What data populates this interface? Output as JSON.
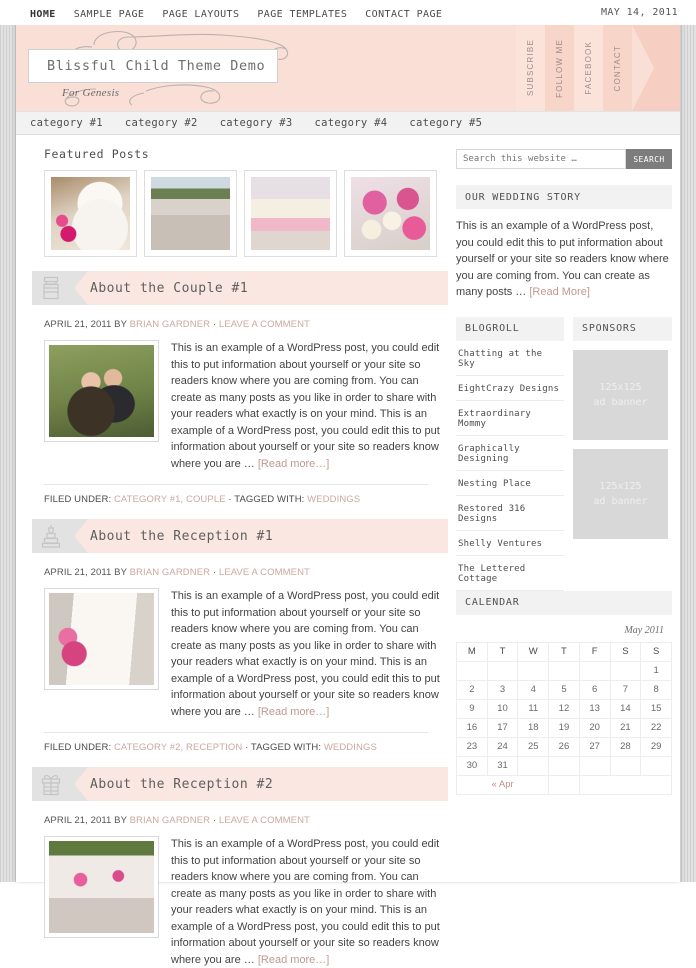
{
  "topnav": {
    "items": [
      {
        "label": "HOME",
        "current": true
      },
      {
        "label": "SAMPLE PAGE",
        "current": false
      },
      {
        "label": "PAGE LAYOUTS",
        "current": false
      },
      {
        "label": "PAGE TEMPLATES",
        "current": false
      },
      {
        "label": "CONTACT PAGE",
        "current": false
      }
    ],
    "date": "MAY 14, 2011"
  },
  "header": {
    "site_title": "Blissful Child Theme Demo",
    "tagline": "For Genesis",
    "bg_color": "#fadfd6",
    "ribbons": [
      "SUBSCRIBE",
      "FOLLOW ME",
      "FACEBOOK",
      "CONTACT"
    ]
  },
  "catnav": {
    "items": [
      "category #1",
      "category #2",
      "category #3",
      "category #4",
      "category #5"
    ]
  },
  "featured": {
    "title": "Featured Posts",
    "items": [
      {
        "name": "wedding-cake-with-flowers"
      },
      {
        "name": "outdoor-reception-tables"
      },
      {
        "name": "place-setting-with-napkin"
      },
      {
        "name": "pink-rose-bouquet"
      }
    ]
  },
  "posts": [
    {
      "icon": "jar-icon",
      "title": "About the Couple #1",
      "date": "APRIL 21, 2011",
      "by": "BY",
      "author": "BRIAN GARDNER",
      "sep": "·",
      "comment": "LEAVE A COMMENT",
      "thumb": "couple-portrait",
      "body": "This is an example of a WordPress post, you could edit this to put information about yourself or your site so readers know where you are coming from. You can create as many posts as you like in order to share with your readers what exactly is on your mind. This is an example of a WordPress post, you could edit this to put information about yourself or your site so readers know where you are … ",
      "more": "[Read more…]",
      "filed_label": "FILED UNDER:",
      "categories": "CATEGORY #1, COUPLE",
      "tagged_label": "TAGGED WITH:",
      "tags": "WEDDINGS"
    },
    {
      "icon": "wedding-cake-icon",
      "title": "About the Reception #1",
      "date": "APRIL 21, 2011",
      "by": "BY",
      "author": "BRIAN GARDNER",
      "sep": "·",
      "comment": "LEAVE A COMMENT",
      "thumb": "tiered-wedding-cake",
      "body": "This is an example of a WordPress post, you could edit this to put information about yourself or your site so readers know where you are coming from. You can create as many posts as you like in order to share with your readers what exactly is on your mind. This is an example of a WordPress post, you could edit this to put information about yourself or your site so readers know where you are … ",
      "more": "[Read more…]",
      "filed_label": "FILED UNDER:",
      "categories": "CATEGORY #2, RECEPTION",
      "tagged_label": "TAGGED WITH:",
      "tags": "WEDDINGS"
    },
    {
      "icon": "gift-box-icon",
      "title": "About the Reception #2",
      "date": "APRIL 21, 2011",
      "by": "BY",
      "author": "BRIAN GARDNER",
      "sep": "·",
      "comment": "LEAVE A COMMENT",
      "thumb": "reception-tables-outdoor",
      "body": "This is an example of a WordPress post, you could edit this to put information about yourself or your site so readers know where you are coming from. You can create as many posts as you like in order to share with your readers what exactly is on your mind. This is an example of a WordPress post, you could edit this to put information about yourself or your site so readers know where you are … ",
      "more": "[Read more…]",
      "filed_label": "",
      "categories": "",
      "tagged_label": "",
      "tags": ""
    }
  ],
  "sidebar": {
    "search": {
      "placeholder": "Search this website …",
      "value": "",
      "button": "SEARCH"
    },
    "story": {
      "title": "OUR WEDDING STORY",
      "body": "This is an example of a WordPress post, you could edit this to put information about yourself or your site so readers know where you are coming from. You can create as many posts … ",
      "more": "[Read More]"
    },
    "blogroll": {
      "title": "BLOGROLL",
      "items": [
        "Chatting at the Sky",
        "EightCrazy Designs",
        "Extraordinary Mommy",
        "Graphically Designing",
        "Nesting Place",
        "Restored 316 Designs",
        "Shelly Ventures",
        "The Lettered Cottage"
      ]
    },
    "sponsors": {
      "title": "SPONSORS",
      "banners": [
        {
          "size": "125x125",
          "label": "ad banner"
        },
        {
          "size": "125x125",
          "label": "ad banner"
        }
      ]
    },
    "calendar": {
      "title": "CALENDAR",
      "caption": "May 2011",
      "weekdays": [
        "M",
        "T",
        "W",
        "T",
        "F",
        "S",
        "S"
      ],
      "weeks": [
        [
          "",
          "",
          "",
          "",
          "",
          "",
          "1"
        ],
        [
          "2",
          "3",
          "4",
          "5",
          "6",
          "7",
          "8"
        ],
        [
          "9",
          "10",
          "11",
          "12",
          "13",
          "14",
          "15"
        ],
        [
          "16",
          "17",
          "18",
          "19",
          "20",
          "21",
          "22"
        ],
        [
          "23",
          "24",
          "25",
          "26",
          "27",
          "28",
          "29"
        ],
        [
          "30",
          "31",
          "",
          "",
          "",
          "",
          ""
        ]
      ],
      "prev": "« Apr",
      "next": ""
    }
  }
}
